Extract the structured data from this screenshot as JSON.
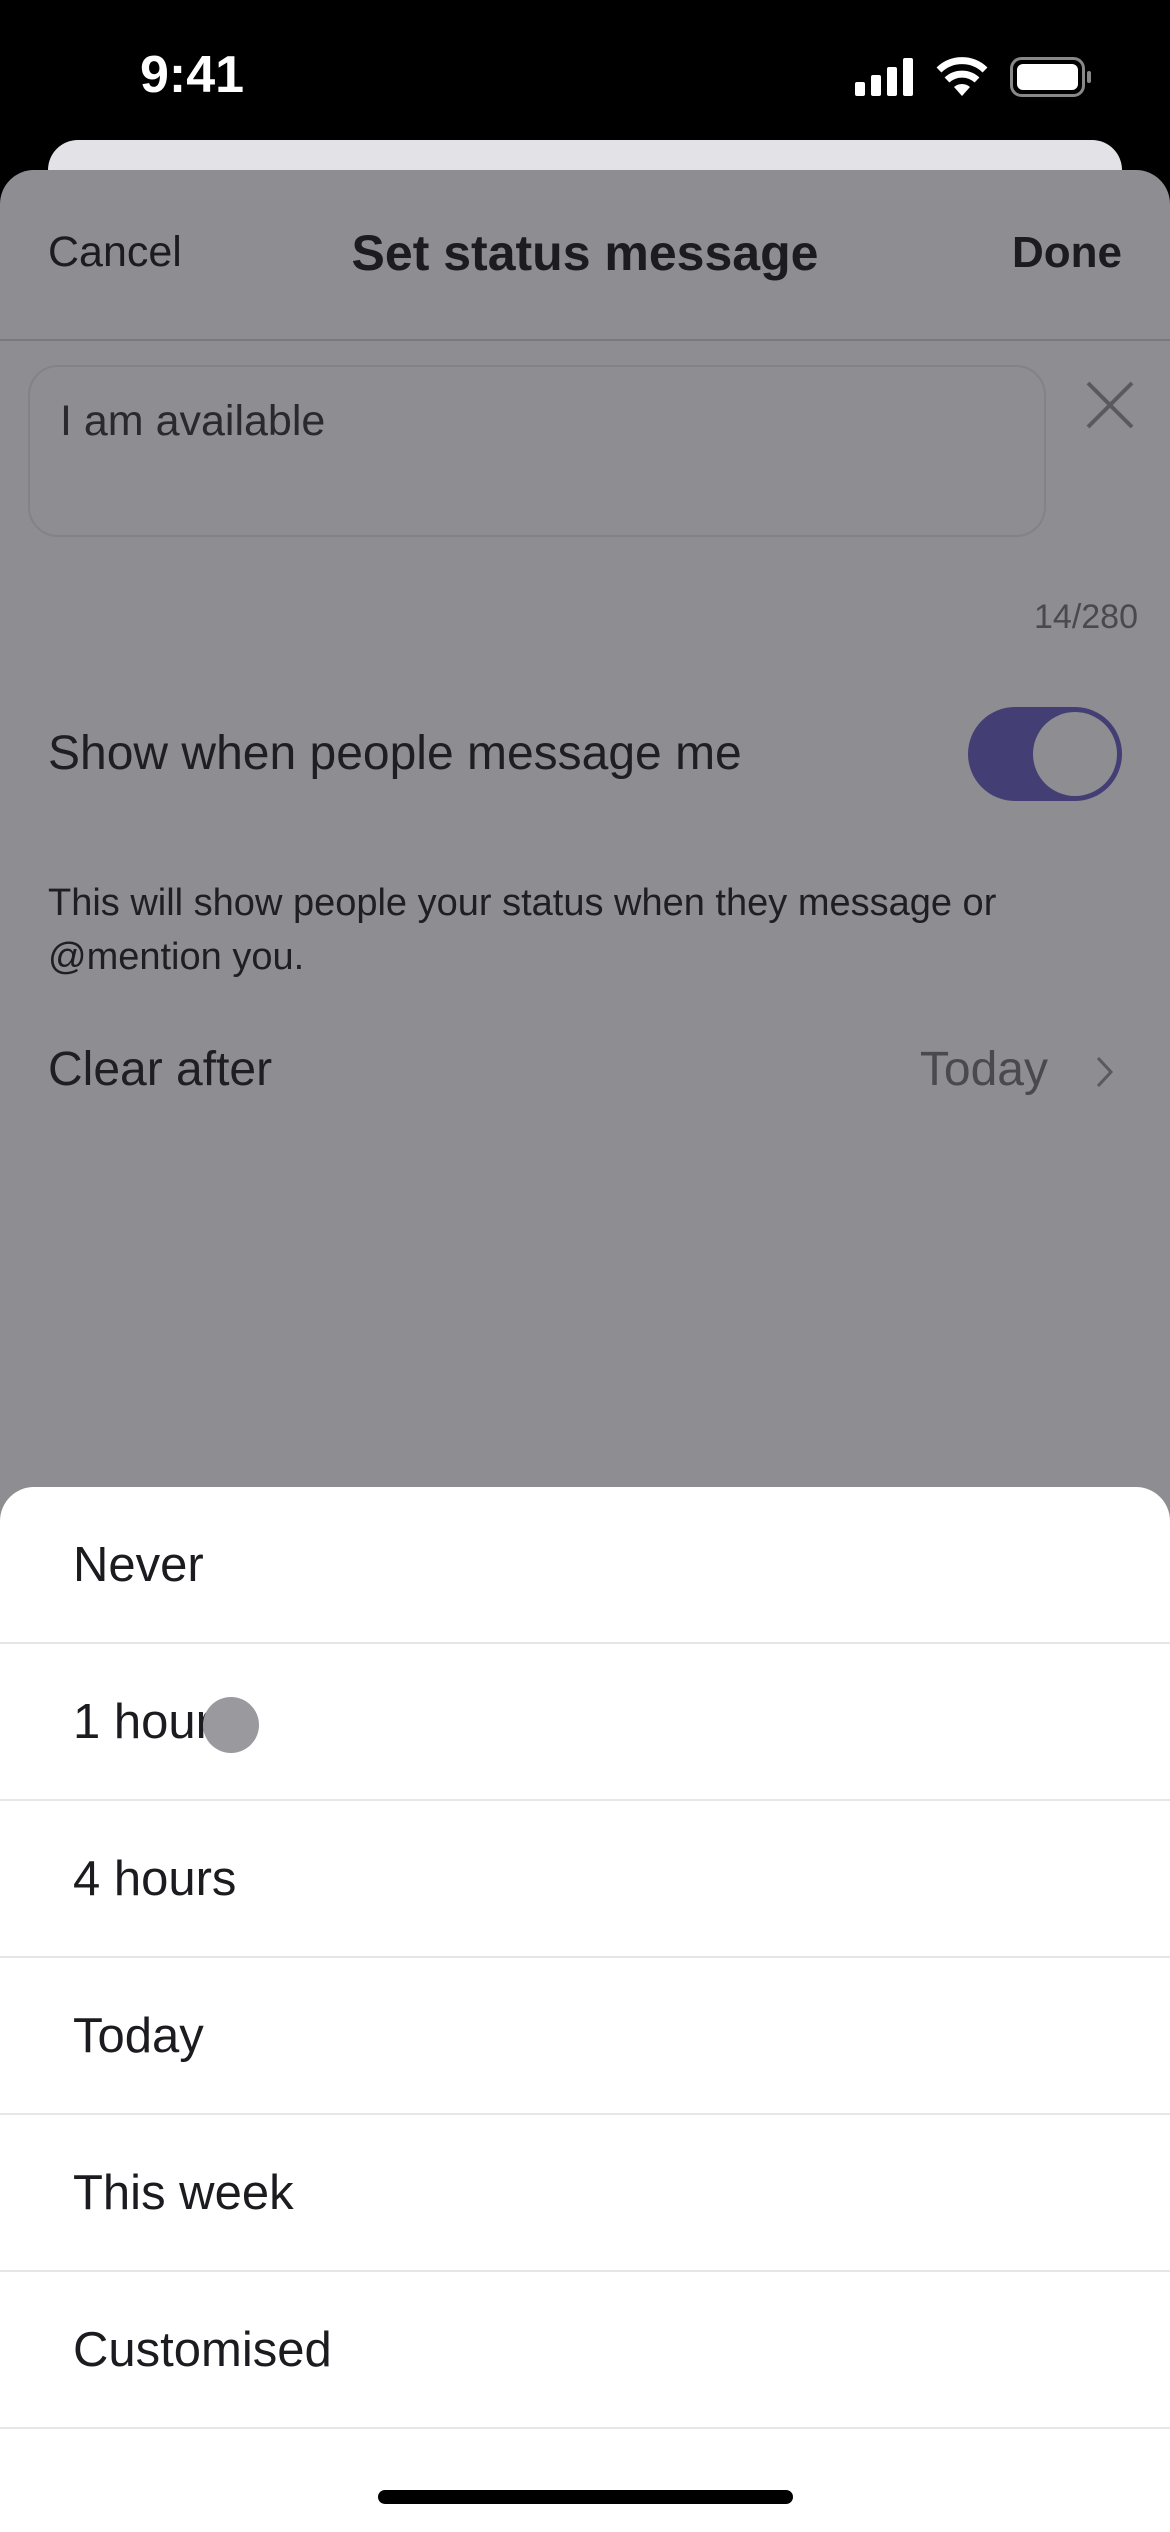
{
  "status_bar": {
    "time": "9:41",
    "icons": [
      "cellular-signal-icon",
      "wifi-icon",
      "battery-icon"
    ]
  },
  "nav": {
    "cancel": "Cancel",
    "title": "Set status message",
    "done": "Done"
  },
  "message_input": {
    "value": "I am available",
    "counter": "14/280",
    "clear_icon": "close-icon"
  },
  "show_when_messaged": {
    "label": "Show when people message me",
    "enabled": true,
    "description": "This will show people your status when they message or @mention you."
  },
  "clear_after": {
    "label": "Clear after",
    "value": "Today"
  },
  "options": [
    {
      "label": "Never"
    },
    {
      "label": "1 hour"
    },
    {
      "label": "4 hours"
    },
    {
      "label": "Today"
    },
    {
      "label": "This week"
    },
    {
      "label": "Customised"
    }
  ],
  "colors": {
    "accent": "#433e74",
    "overlay": "#8e8d91"
  }
}
